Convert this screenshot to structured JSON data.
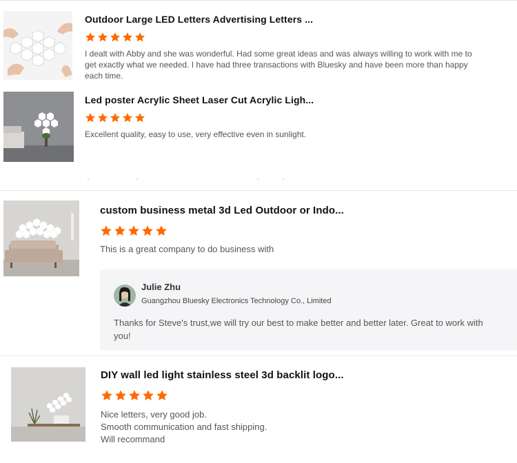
{
  "colors": {
    "star": "#ff6a00",
    "divider": "#e4e4e4",
    "reply_bg": "#f5f5f7"
  },
  "reviews": [
    {
      "title": "Outdoor Large LED Letters Advertising Letters ...",
      "rating": 5,
      "text": "I dealt with Abby and she was wonderful. Had some great ideas and was always willing to work with me to get exactly what we needed. I have had three transactions with Bluesky and have been more than happy each time.",
      "image": "hexagon-lights-hand-photo"
    },
    {
      "title": "Led poster Acrylic Sheet Laser Cut Acrylic Ligh...",
      "rating": 5,
      "text": "Excellent quality, easy to use, very effective even in sunlight.",
      "image": "heart-light-room-photo"
    },
    {
      "title": "custom business metal 3d Led Outdoor or Indo...",
      "rating": 5,
      "text": "This is a great company to do business with",
      "image": "cloud-light-sofa-photo",
      "reply": {
        "name": "Julie Zhu",
        "company": "Guangzhou Bluesky Electronics Technology Co., Limited",
        "text": "Thanks for Steve's trust,we will try our best to make better and better later. Great to work with you!"
      }
    },
    {
      "title": "DIY wall led light stainless steel 3d backlit logo...",
      "rating": 5,
      "text_lines": [
        "Nice letters, very good job.",
        "Smooth communication and fast shipping.",
        "Will recommand"
      ],
      "image": "hexagon-strip-shelf-photo"
    }
  ]
}
